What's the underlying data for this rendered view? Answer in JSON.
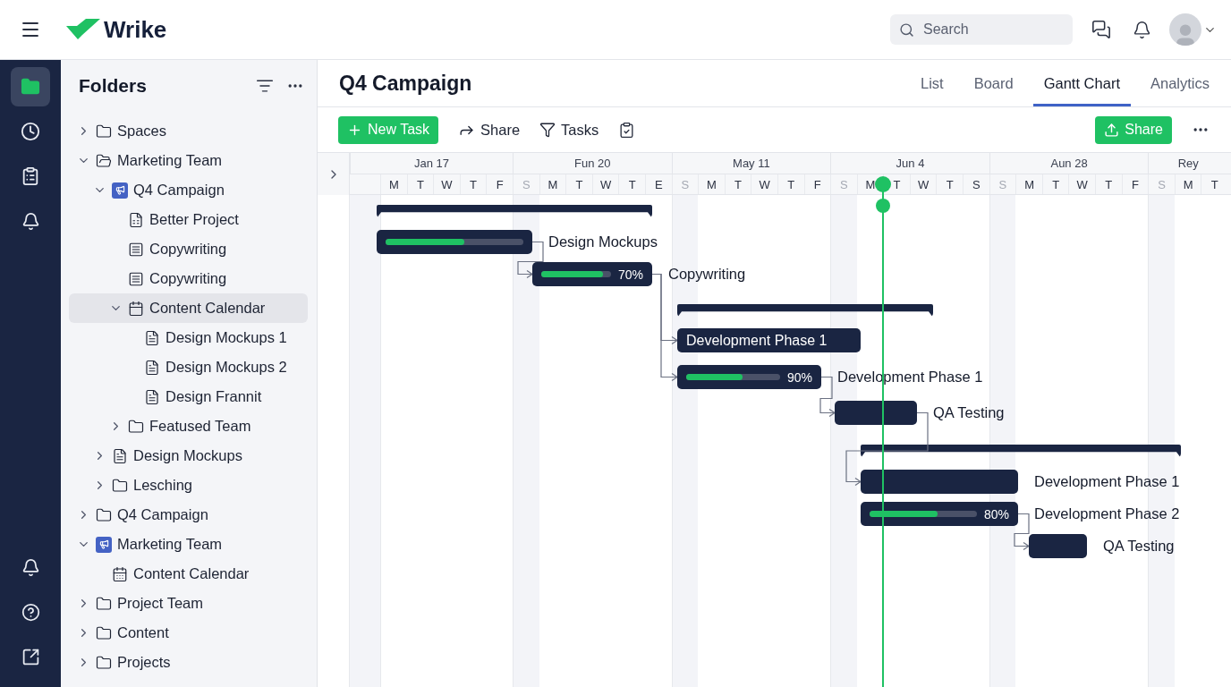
{
  "topbar": {
    "logo": "Wrike",
    "search": {
      "placeholder": "Search"
    }
  },
  "rail": {
    "top": [
      {
        "kind": "folder",
        "selected": true
      },
      {
        "kind": "clock",
        "selected": false
      },
      {
        "kind": "clipboard",
        "selected": false
      },
      {
        "kind": "bell",
        "selected": false
      }
    ],
    "bottom": [
      {
        "kind": "bell"
      },
      {
        "kind": "help"
      },
      {
        "kind": "external"
      }
    ]
  },
  "sidebar": {
    "title": "Folders",
    "items": [
      {
        "label": "Spaces",
        "kind": "folder",
        "expanded": false,
        "selected": false
      },
      {
        "label": "Marketing Team",
        "kind": "folder",
        "expanded": true,
        "selected": false,
        "children": [
          {
            "label": "Q4 Campaign",
            "kind": "project",
            "expanded": true,
            "selected": false,
            "children": [
              {
                "label": "Better Project",
                "kind": "sheet",
                "selected": false
              },
              {
                "label": "Copywriting",
                "kind": "note",
                "selected": false
              },
              {
                "label": "Copywriting",
                "kind": "note",
                "selected": false
              },
              {
                "label": "Content Calendar",
                "kind": "calendar",
                "expanded": true,
                "selected": true,
                "children": [
                  {
                    "label": "Design Mockups 1",
                    "kind": "doc",
                    "selected": false
                  },
                  {
                    "label": "Design Mockups 2",
                    "kind": "doc",
                    "selected": false
                  },
                  {
                    "label": "Design Frannit",
                    "kind": "doc",
                    "selected": false
                  }
                ]
              },
              {
                "label": "Featused Team",
                "kind": "folder",
                "expanded": false,
                "selected": false
              }
            ]
          },
          {
            "label": "Design Mockups",
            "kind": "doc",
            "expanded": false,
            "selected": false
          },
          {
            "label": "Lesching",
            "kind": "folder",
            "expanded": false,
            "selected": false
          }
        ]
      },
      {
        "label": "Q4 Campaign",
        "kind": "folder",
        "expanded": false,
        "selected": false
      },
      {
        "label": "Marketing Team",
        "kind": "project",
        "expanded": true,
        "selected": false,
        "children": [
          {
            "label": "Content Calendar",
            "kind": "grid-calendar",
            "selected": false
          }
        ]
      },
      {
        "label": "Project Team",
        "kind": "folder",
        "expanded": false,
        "selected": false
      },
      {
        "label": "Content",
        "kind": "folder",
        "expanded": false,
        "selected": false
      },
      {
        "label": "Projects",
        "kind": "folder",
        "expanded": false,
        "selected": false
      }
    ]
  },
  "header": {
    "title": "Q4 Campaign",
    "tabs": [
      {
        "label": "List",
        "selected": false
      },
      {
        "label": "Board",
        "selected": false
      },
      {
        "label": "Gantt Chart",
        "selected": true
      },
      {
        "label": "Analytics",
        "selected": false
      }
    ]
  },
  "toolbar": {
    "new_task": "New Task",
    "share": "Share",
    "tasks": "Tasks",
    "share_primary": "Share"
  },
  "timeline": {
    "months": [
      {
        "label": "Jan 17",
        "days": [
          {
            "letter": "M"
          },
          {
            "letter": "T"
          },
          {
            "letter": "W"
          },
          {
            "letter": "T"
          },
          {
            "letter": "F"
          }
        ]
      },
      {
        "label": "Fun 20",
        "days": [
          {
            "letter": "S",
            "weekend": true
          },
          {
            "letter": "M"
          },
          {
            "letter": "T"
          },
          {
            "letter": "W"
          },
          {
            "letter": "T"
          },
          {
            "letter": "E"
          }
        ]
      },
      {
        "label": "May 11",
        "days": [
          {
            "letter": "S",
            "weekend": true
          },
          {
            "letter": "M"
          },
          {
            "letter": "T"
          },
          {
            "letter": "W"
          },
          {
            "letter": "T"
          },
          {
            "letter": "F"
          }
        ]
      },
      {
        "label": "Jun 4",
        "days": [
          {
            "letter": "S",
            "weekend": true
          },
          {
            "letter": "M",
            "today": true
          },
          {
            "letter": "T"
          },
          {
            "letter": "W"
          },
          {
            "letter": "T"
          },
          {
            "letter": "S"
          }
        ]
      },
      {
        "label": "Aun 28",
        "days": [
          {
            "letter": "S",
            "weekend": true
          },
          {
            "letter": "M"
          },
          {
            "letter": "T"
          },
          {
            "letter": "W"
          },
          {
            "letter": "T"
          },
          {
            "letter": "F"
          }
        ]
      },
      {
        "label": "Rey",
        "days": [
          {
            "letter": "S",
            "weekend": true
          },
          {
            "letter": "M"
          },
          {
            "letter": "T"
          }
        ]
      }
    ],
    "bars": [
      {
        "kind": "summary"
      },
      {
        "kind": "task",
        "label": "Design Mockups",
        "level": 0.57
      },
      {
        "kind": "task",
        "label": "Copywriting",
        "level": 0.88,
        "percent": "70%",
        "linked": true
      },
      {
        "kind": "summary"
      },
      {
        "kind": "task",
        "bar_text": "Development Phase 1",
        "linked": true
      },
      {
        "kind": "task",
        "label": "Development Phase 1",
        "level": 0.6,
        "percent": "90%",
        "linked": true
      },
      {
        "kind": "task",
        "label": "QA Testing",
        "linked": true
      },
      {
        "kind": "summary"
      },
      {
        "kind": "task",
        "label": "Development Phase 1",
        "linked": true
      },
      {
        "kind": "task",
        "label": "Development Phase 2",
        "level": 0.63,
        "percent": "80%"
      },
      {
        "kind": "task",
        "label": "QA Testing",
        "linked": true
      }
    ]
  }
}
